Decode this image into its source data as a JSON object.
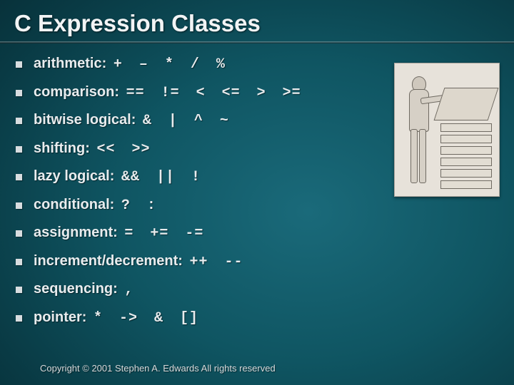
{
  "title": "C Expression Classes",
  "items": [
    {
      "label": "arithmetic:",
      "ops": "+ – * / %"
    },
    {
      "label": "comparison:",
      "ops": "== != < <= > >="
    },
    {
      "label": "bitwise logical:",
      "ops": "& | ^ ~"
    },
    {
      "label": "shifting:",
      "ops": "<< >>"
    },
    {
      "label": "lazy logical:",
      "ops": "&& || !"
    },
    {
      "label": "conditional:",
      "ops": "? :"
    },
    {
      "label": "assignment:",
      "ops": "= += -="
    },
    {
      "label": "increment/decrement:",
      "ops": "++ --"
    },
    {
      "label": "sequencing:",
      "ops": ","
    },
    {
      "label": "pointer:",
      "ops": "* -> & []"
    }
  ],
  "footer": "Copyright © 2001 Stephen A. Edwards  All rights reserved",
  "figure_alt": "woodcut-person-at-cabinet"
}
